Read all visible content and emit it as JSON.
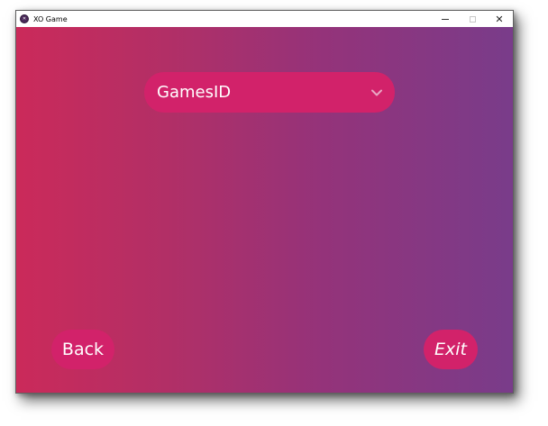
{
  "window": {
    "title": "XO Game",
    "icon": "xo-game-icon",
    "controls": {
      "minimize_icon": "minimize-icon",
      "maximize_icon": "maximize-icon",
      "close_glyph": "✕"
    }
  },
  "main": {
    "games_dropdown": {
      "selected": "GamesID",
      "icon": "chevron-down-icon"
    },
    "back_button": "Back",
    "exit_button": "Exit"
  },
  "colors": {
    "gradient_left": "#cb2a5a",
    "gradient_right": "#793c8a",
    "button": "#d2226a",
    "text": "#ffffff"
  }
}
